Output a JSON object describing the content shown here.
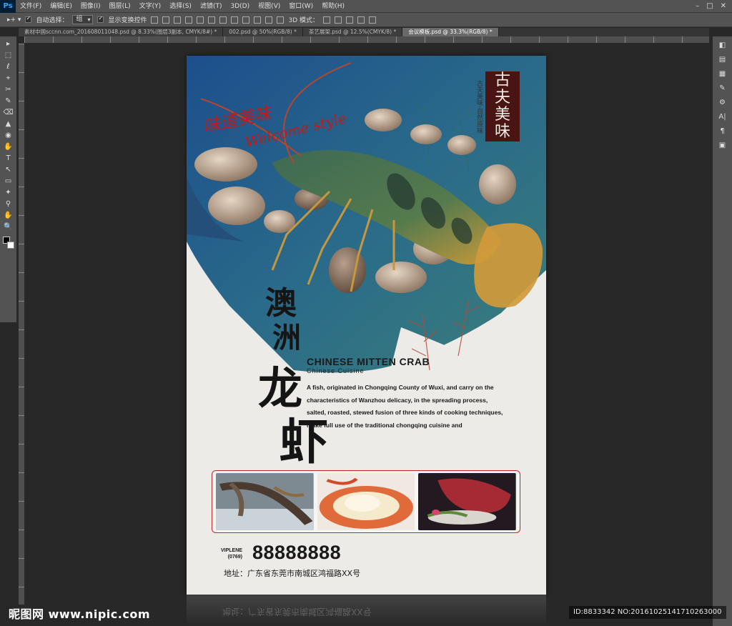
{
  "menubar": {
    "logo": "Ps",
    "items": [
      "文件(F)",
      "编辑(E)",
      "图像(I)",
      "图层(L)",
      "文字(Y)",
      "选择(S)",
      "滤镜(T)",
      "3D(D)",
      "视图(V)",
      "窗口(W)",
      "帮助(H)"
    ],
    "controls": [
      "–",
      "□",
      "✕"
    ]
  },
  "options": {
    "auto_select_label": "自动选择：",
    "auto_select_value": "组",
    "show_transform_label": "显示变换控件",
    "mode_label": "3D 模式："
  },
  "tabs": [
    {
      "label": "素材中国sccnn.com_20160801104​8.psd @ 8.33%(图层3副本, CMYK/8#) *",
      "active": false
    },
    {
      "label": "002.psd @ 50%(RGB/8) *",
      "active": false
    },
    {
      "label": "茶艺展架.psd @ 12.5%(CMYK/8) *",
      "active": false
    },
    {
      "label": "会议模板.psd @ 33.3%(RGB/8) *",
      "active": true
    }
  ],
  "tools": [
    "▸",
    "⬚",
    "ℓ",
    "⌖",
    "✂",
    "✎",
    "⌫",
    "▲",
    "◉",
    "✋",
    "T",
    "↖",
    "▭",
    "✦",
    "⚲",
    "✋",
    "🔍"
  ],
  "right_tools": [
    "◧",
    "▤",
    "▦",
    "✎",
    "⚙",
    "A|",
    "¶",
    "▣"
  ],
  "poster": {
    "script_chinese": "味道美味",
    "script_english": "Welcome style",
    "seal_text": [
      "古",
      "夫",
      "美",
      "味"
    ],
    "vertical_small": "古夫美味·自然原味",
    "title_chars": [
      "澳",
      "洲",
      "龙",
      "虾"
    ],
    "headline": "CHINESE MITTEN CRAB",
    "subheadline": "Chinese  Cuisine",
    "description": "A fish, originated in Chongqing County of Wuxi, and carry on the characteristics of Wanzhou delicacy, in the spreading process, salted, roasted, stewed fusion of three kinds of cooking techniques, make full use of the traditional chongqing cuisine and",
    "phone_label_1": "VIPLENE",
    "phone_label_2": "(0769)",
    "phone_number": "88888888",
    "address": "地址：广东省东莞市南城区鸿福路XX号",
    "reflection_text": "地址：广东省东莞市南城区鸿福路XX号"
  },
  "colors": {
    "seal_bg": "#4a1414",
    "accent_red": "#c21a1a",
    "frame_red": "#c0262a",
    "poster_bg": "#ecebe8"
  },
  "watermark": {
    "left": "昵图网 www.nipic.com",
    "right": "ID:8833342 NO:20161025141710263000"
  }
}
